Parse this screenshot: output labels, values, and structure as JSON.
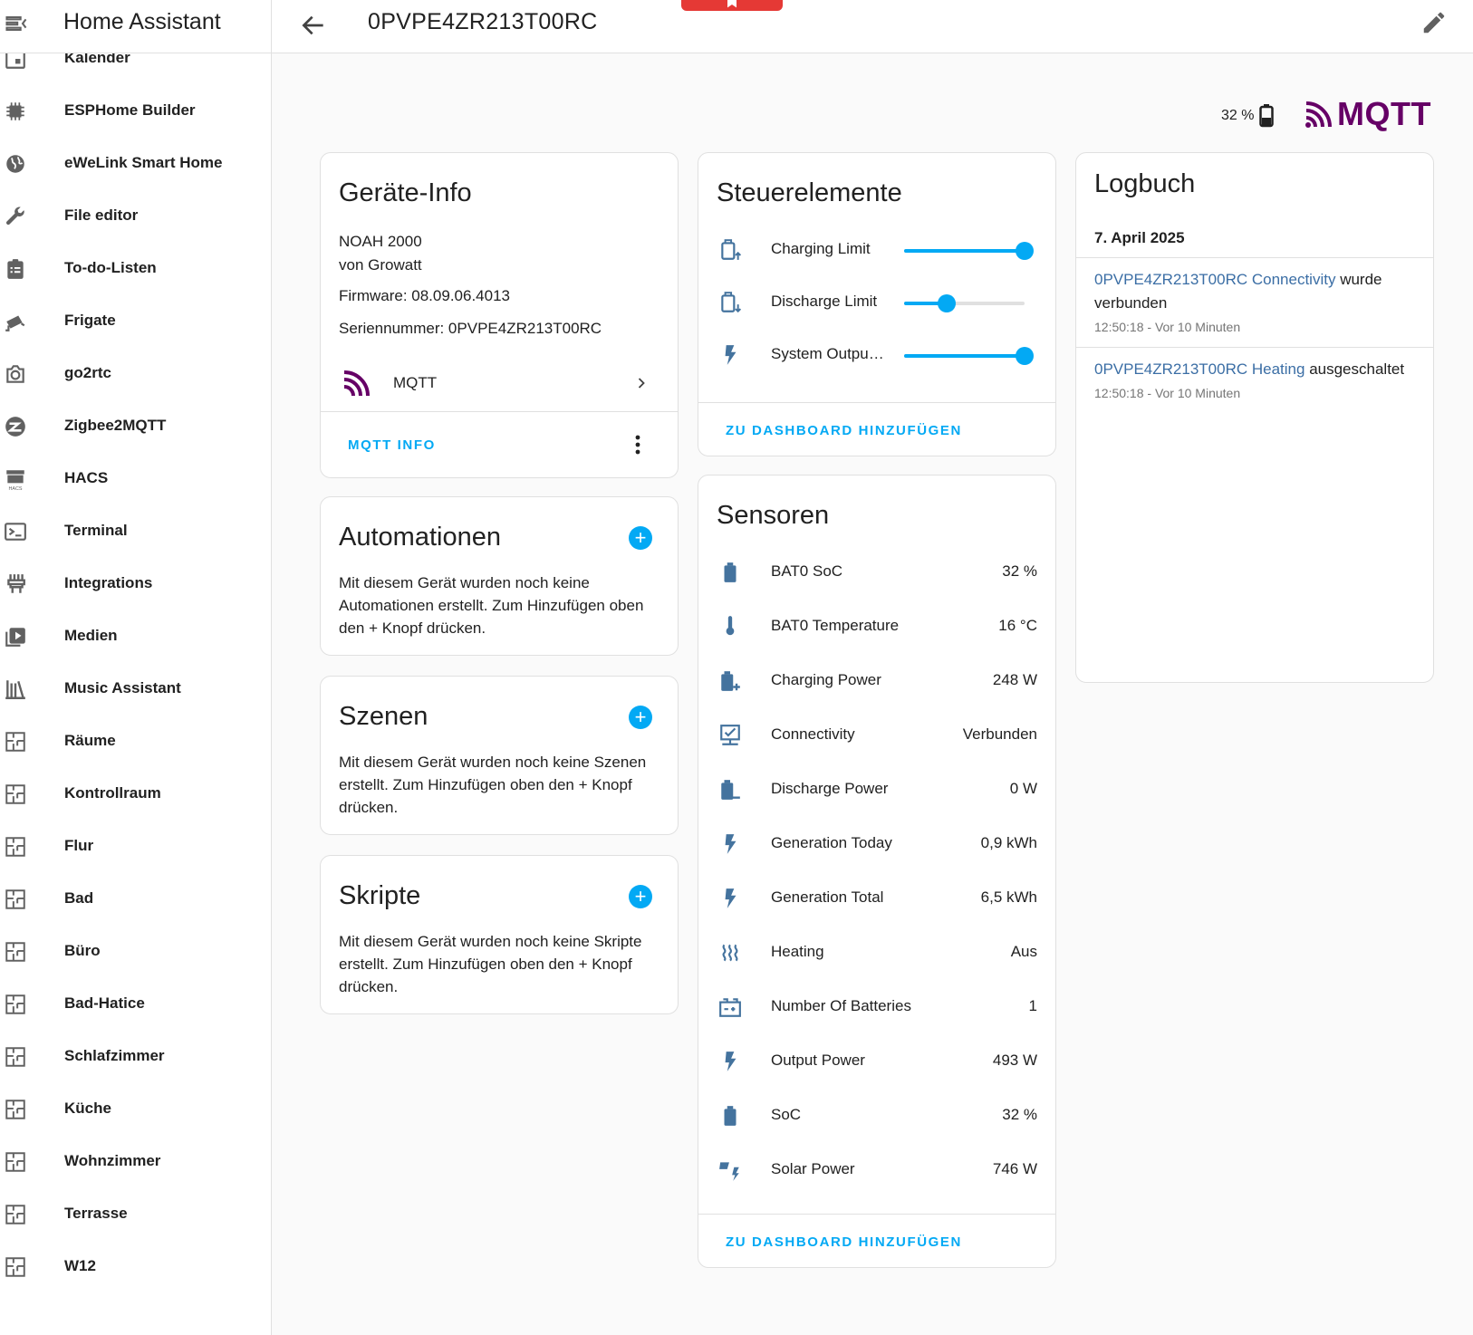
{
  "app": {
    "title": "Home Assistant"
  },
  "sidebar": {
    "items": [
      {
        "label": "Kalender",
        "icon": "calendar-icon"
      },
      {
        "label": "ESPHome Builder",
        "icon": "chip-icon"
      },
      {
        "label": "eWeLink Smart Home",
        "icon": "globe-icon"
      },
      {
        "label": "File editor",
        "icon": "wrench-icon"
      },
      {
        "label": "To-do-Listen",
        "icon": "clipboard-list-icon"
      },
      {
        "label": "Frigate",
        "icon": "cctv-icon"
      },
      {
        "label": "go2rtc",
        "icon": "camera-icon"
      },
      {
        "label": "Zigbee2MQTT",
        "icon": "zigbee-icon"
      },
      {
        "label": "HACS",
        "icon": "hacs-icon"
      },
      {
        "label": "Terminal",
        "icon": "console-icon"
      },
      {
        "label": "Integrations",
        "icon": "plug-icon"
      },
      {
        "label": "Medien",
        "icon": "play-box-icon"
      },
      {
        "label": "Music Assistant",
        "icon": "library-icon"
      },
      {
        "label": "Räume",
        "icon": "floor-plan-icon"
      },
      {
        "label": "Kontrollraum",
        "icon": "floor-plan-icon"
      },
      {
        "label": "Flur",
        "icon": "floor-plan-icon"
      },
      {
        "label": "Bad",
        "icon": "floor-plan-icon"
      },
      {
        "label": "Büro",
        "icon": "floor-plan-icon"
      },
      {
        "label": "Bad-Hatice",
        "icon": "floor-plan-icon"
      },
      {
        "label": "Schlafzimmer",
        "icon": "floor-plan-icon"
      },
      {
        "label": "Küche",
        "icon": "floor-plan-icon"
      },
      {
        "label": "Wohnzimmer",
        "icon": "floor-plan-icon"
      },
      {
        "label": "Terrasse",
        "icon": "floor-plan-icon"
      },
      {
        "label": "W12",
        "icon": "floor-plan-icon"
      }
    ]
  },
  "topbar": {
    "title": "0PVPE4ZR213T00RC"
  },
  "brand": {
    "battery": "32 %",
    "logo_text": "MQTT",
    "logo_color": "#660066"
  },
  "device_info": {
    "title": "Geräte-Info",
    "model": "NOAH 2000",
    "manufacturer": "von Growatt",
    "firmware": "Firmware: 08.09.06.4013",
    "serial": "Seriennummer: 0PVPE4ZR213T00RC",
    "integration": "MQTT",
    "action": "MQTT INFO"
  },
  "automations": {
    "title": "Automationen",
    "text": "Mit diesem Gerät wurden noch keine Automationen erstellt. Zum Hinzufügen oben den + Knopf drücken."
  },
  "scenes": {
    "title": "Szenen",
    "text": "Mit diesem Gerät wurden noch keine Szenen erstellt. Zum Hinzufügen oben den + Knopf drücken."
  },
  "scripts": {
    "title": "Skripte",
    "text": "Mit diesem Gerät wurden noch keine Skripte erstellt. Zum Hinzufügen oben den + Knopf drücken."
  },
  "controls": {
    "title": "Steuerelemente",
    "items": [
      {
        "label": "Charging Limit",
        "icon": "battery-charging-limit-icon",
        "value": 1.0
      },
      {
        "label": "Discharge Limit",
        "icon": "battery-discharge-limit-icon",
        "value": 0.35
      },
      {
        "label": "System Outpu…",
        "icon": "flash-icon",
        "value": 1.0
      }
    ],
    "action": "ZU DASHBOARD HINZUFÜGEN"
  },
  "sensors": {
    "title": "Sensoren",
    "items": [
      {
        "label": "BAT0 SoC",
        "value": "32 %",
        "icon": "battery-icon"
      },
      {
        "label": "BAT0 Temperature",
        "value": "16 °C",
        "icon": "thermometer-icon"
      },
      {
        "label": "Charging Power",
        "value": "248 W",
        "icon": "battery-plus-icon"
      },
      {
        "label": "Connectivity",
        "value": "Verbunden",
        "icon": "lan-connect-icon"
      },
      {
        "label": "Discharge Power",
        "value": "0 W",
        "icon": "battery-minus-icon"
      },
      {
        "label": "Generation Today",
        "value": "0,9 kWh",
        "icon": "flash-icon"
      },
      {
        "label": "Generation Total",
        "value": "6,5 kWh",
        "icon": "flash-icon"
      },
      {
        "label": "Heating",
        "value": "Aus",
        "icon": "heat-wave-icon"
      },
      {
        "label": "Number Of Batteries",
        "value": "1",
        "icon": "car-battery-icon"
      },
      {
        "label": "Output Power",
        "value": "493 W",
        "icon": "flash-icon"
      },
      {
        "label": "SoC",
        "value": "32 %",
        "icon": "battery-icon"
      },
      {
        "label": "Solar Power",
        "value": "746 W",
        "icon": "solar-power-icon"
      }
    ],
    "action": "ZU DASHBOARD HINZUFÜGEN"
  },
  "logbook": {
    "title": "Logbuch",
    "date": "7. April 2025",
    "entries": [
      {
        "entity": "0PVPE4ZR213T00RC Connectivity",
        "text": " wurde verbunden",
        "time": "12:50:18 - Vor 10 Minuten"
      },
      {
        "entity": "0PVPE4ZR213T00RC Heating",
        "text": " ausgeschaltet",
        "time": "12:50:18 - Vor 10 Minuten"
      }
    ]
  },
  "colors": {
    "accent": "#03a9f4",
    "icon": "#44739e",
    "entity_link": "#3b6ea5"
  }
}
